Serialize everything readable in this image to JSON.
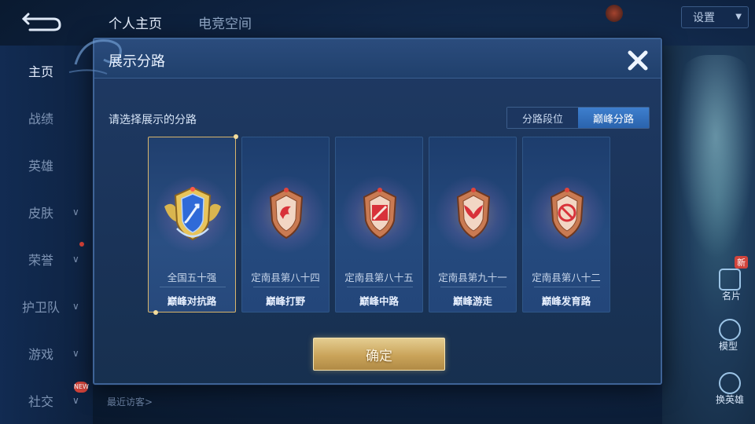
{
  "top_tabs": [
    "个人主页",
    "电竞空间"
  ],
  "left_nav": [
    {
      "label": "主页",
      "active": true,
      "chevron": false,
      "dot": false
    },
    {
      "label": "战绩",
      "active": false,
      "chevron": false,
      "dot": false
    },
    {
      "label": "英雄",
      "active": false,
      "chevron": false,
      "dot": false
    },
    {
      "label": "皮肤",
      "active": false,
      "chevron": true,
      "dot": false
    },
    {
      "label": "荣誉",
      "active": false,
      "chevron": true,
      "dot": true
    },
    {
      "label": "护卫队",
      "active": false,
      "chevron": true,
      "dot": false
    },
    {
      "label": "游戏",
      "active": false,
      "chevron": true,
      "dot": false
    },
    {
      "label": "社交",
      "active": false,
      "chevron": true,
      "dot": false
    }
  ],
  "new_badge": "NEW",
  "recent_visitors": "最近访客>",
  "settings_label": "设置",
  "right_rail": {
    "new_tag": "新",
    "card_label": "名片",
    "model_label": "模型",
    "switch_hero_label": "换英雄"
  },
  "modal": {
    "title": "展示分路",
    "prompt": "请选择展示的分路",
    "toggle": [
      {
        "label": "分路段位",
        "active": false
      },
      {
        "label": "巅峰分路",
        "active": true
      }
    ],
    "cards": [
      {
        "rank": "全国五十强",
        "lane": "巅峰对抗路",
        "selected": true,
        "badge_style": "gold",
        "emblem": "sword"
      },
      {
        "rank": "定南县第八十四",
        "lane": "巅峰打野",
        "selected": false,
        "badge_style": "bronze",
        "emblem": "claw"
      },
      {
        "rank": "定南县第八十五",
        "lane": "巅峰中路",
        "selected": false,
        "badge_style": "bronze",
        "emblem": "slash"
      },
      {
        "rank": "定南县第九十一",
        "lane": "巅峰游走",
        "selected": false,
        "badge_style": "bronze",
        "emblem": "wings"
      },
      {
        "rank": "定南县第八十二",
        "lane": "巅峰发育路",
        "selected": false,
        "badge_style": "bronze",
        "emblem": "target"
      }
    ],
    "confirm_label": "确定"
  },
  "colors": {
    "accent_blue": "#2a63ad",
    "gold_border": "#d8b56b",
    "confirm_gold": "#caa45a"
  }
}
